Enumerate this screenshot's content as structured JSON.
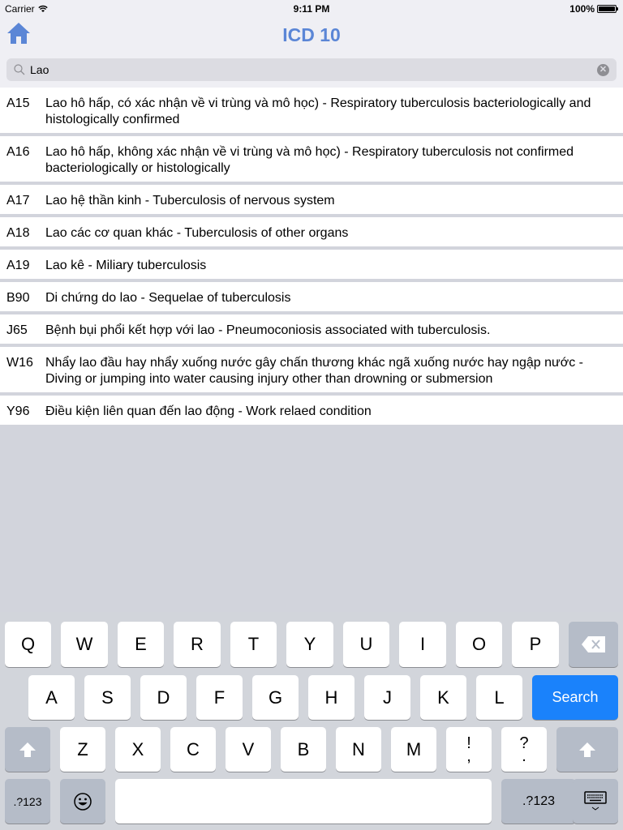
{
  "status_bar": {
    "carrier": "Carrier",
    "time": "9:11 PM",
    "battery": "100%",
    "battery_level": 1.0
  },
  "nav": {
    "title": "ICD 10",
    "home_icon": "home-icon",
    "accent_color": "#5b86d6"
  },
  "search": {
    "value": "Lao",
    "placeholder": "",
    "clear_icon": "clear-icon"
  },
  "results": [
    {
      "code": "A15",
      "description": "Lao hô hấp, có xác nhận về vi trùng và mô học)  - Respiratory tuberculosis bacteriologically and histologically confirmed"
    },
    {
      "code": "A16",
      "description": "Lao hô hấp, không xác nhận về vi trùng và mô học)  - Respiratory tuberculosis not confirmed bacteriologically or histologically"
    },
    {
      "code": "A17",
      "description": "Lao hệ thần kinh  - Tuberculosis of nervous system"
    },
    {
      "code": "A18",
      "description": "Lao các cơ quan khác  - Tuberculosis of other organs"
    },
    {
      "code": "A19",
      "description": "Lao kê  - Miliary tuberculosis"
    },
    {
      "code": "B90",
      "description": "Di chứng do lao  - Sequelae of tuberculosis"
    },
    {
      "code": "J65",
      "description": "Bệnh bụi phổi kết hợp với lao  - Pneumoconiosis associated with tuberculosis."
    },
    {
      "code": "W16",
      "description": "Nhẩy lao đầu hay nhẩy xuống nước gây chấn thương khác ngã xuống nước hay ngập nước  - Diving or jumping into water causing injury other than drowning or submersion"
    },
    {
      "code": "Y96",
      "description": "Điều kiện liên quan đến lao động  - Work relaed condition"
    }
  ],
  "keyboard": {
    "row1": [
      "Q",
      "W",
      "E",
      "R",
      "T",
      "Y",
      "U",
      "I",
      "O",
      "P"
    ],
    "row2": [
      "A",
      "S",
      "D",
      "F",
      "G",
      "H",
      "J",
      "K",
      "L"
    ],
    "row3": [
      "Z",
      "X",
      "C",
      "V",
      "B",
      "N",
      "M"
    ],
    "punct1": {
      "top": "!",
      "bottom": ","
    },
    "punct2": {
      "top": "?",
      "bottom": "."
    },
    "search_label": "Search",
    "numbers_label": ".?123",
    "search_color": "#1a82fb"
  }
}
